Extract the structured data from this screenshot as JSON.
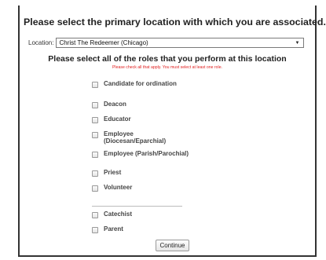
{
  "title": "Please select the primary location with which you are associated.",
  "location": {
    "label": "Location:",
    "selected": "Christ The Redeemer (Chicago)",
    "caret_icon": "triangle-down"
  },
  "roles_heading": "Please select all of the roles that you perform at this location",
  "instructions": "Please check all that apply. You must select at least one role.",
  "roles": [
    {
      "label": "Candidate for ordination",
      "checked": false
    },
    {
      "label": "Deacon",
      "checked": false
    },
    {
      "label": "Educator",
      "checked": false
    },
    {
      "label": "Employee (Diocesan/Eparchial)",
      "checked": false
    },
    {
      "label": "Employee (Parish/Parochial)",
      "checked": false
    },
    {
      "label": "Priest",
      "checked": false
    },
    {
      "label": "Volunteer",
      "checked": false
    },
    {
      "label": "Catechist",
      "checked": false
    },
    {
      "label": "Parent",
      "checked": false
    }
  ],
  "continue_label": "Continue",
  "colors": {
    "instruction_text": "#e02020",
    "frame_border": "#333333"
  }
}
